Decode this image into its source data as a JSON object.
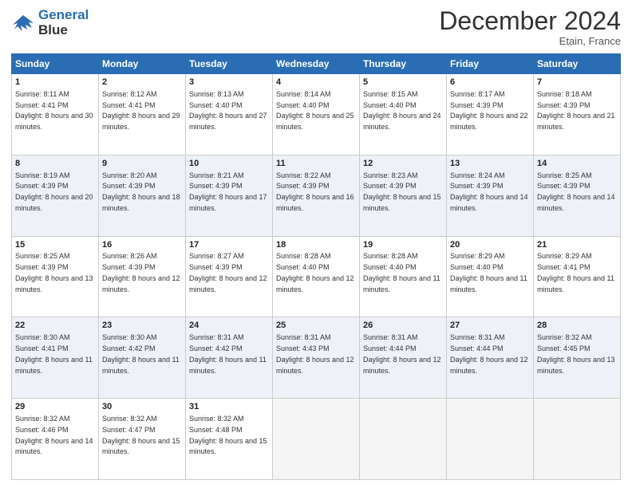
{
  "header": {
    "logo_line1": "General",
    "logo_line2": "Blue",
    "month": "December 2024",
    "location": "Etain, France"
  },
  "weekdays": [
    "Sunday",
    "Monday",
    "Tuesday",
    "Wednesday",
    "Thursday",
    "Friday",
    "Saturday"
  ],
  "weeks": [
    [
      {
        "day": "1",
        "sunrise": "8:11 AM",
        "sunset": "4:41 PM",
        "daylight": "8 hours and 30 minutes."
      },
      {
        "day": "2",
        "sunrise": "8:12 AM",
        "sunset": "4:41 PM",
        "daylight": "8 hours and 29 minutes."
      },
      {
        "day": "3",
        "sunrise": "8:13 AM",
        "sunset": "4:40 PM",
        "daylight": "8 hours and 27 minutes."
      },
      {
        "day": "4",
        "sunrise": "8:14 AM",
        "sunset": "4:40 PM",
        "daylight": "8 hours and 25 minutes."
      },
      {
        "day": "5",
        "sunrise": "8:15 AM",
        "sunset": "4:40 PM",
        "daylight": "8 hours and 24 minutes."
      },
      {
        "day": "6",
        "sunrise": "8:17 AM",
        "sunset": "4:39 PM",
        "daylight": "8 hours and 22 minutes."
      },
      {
        "day": "7",
        "sunrise": "8:18 AM",
        "sunset": "4:39 PM",
        "daylight": "8 hours and 21 minutes."
      }
    ],
    [
      {
        "day": "8",
        "sunrise": "8:19 AM",
        "sunset": "4:39 PM",
        "daylight": "8 hours and 20 minutes."
      },
      {
        "day": "9",
        "sunrise": "8:20 AM",
        "sunset": "4:39 PM",
        "daylight": "8 hours and 18 minutes."
      },
      {
        "day": "10",
        "sunrise": "8:21 AM",
        "sunset": "4:39 PM",
        "daylight": "8 hours and 17 minutes."
      },
      {
        "day": "11",
        "sunrise": "8:22 AM",
        "sunset": "4:39 PM",
        "daylight": "8 hours and 16 minutes."
      },
      {
        "day": "12",
        "sunrise": "8:23 AM",
        "sunset": "4:39 PM",
        "daylight": "8 hours and 15 minutes."
      },
      {
        "day": "13",
        "sunrise": "8:24 AM",
        "sunset": "4:39 PM",
        "daylight": "8 hours and 14 minutes."
      },
      {
        "day": "14",
        "sunrise": "8:25 AM",
        "sunset": "4:39 PM",
        "daylight": "8 hours and 14 minutes."
      }
    ],
    [
      {
        "day": "15",
        "sunrise": "8:25 AM",
        "sunset": "4:39 PM",
        "daylight": "8 hours and 13 minutes."
      },
      {
        "day": "16",
        "sunrise": "8:26 AM",
        "sunset": "4:39 PM",
        "daylight": "8 hours and 12 minutes."
      },
      {
        "day": "17",
        "sunrise": "8:27 AM",
        "sunset": "4:39 PM",
        "daylight": "8 hours and 12 minutes."
      },
      {
        "day": "18",
        "sunrise": "8:28 AM",
        "sunset": "4:40 PM",
        "daylight": "8 hours and 12 minutes."
      },
      {
        "day": "19",
        "sunrise": "8:28 AM",
        "sunset": "4:40 PM",
        "daylight": "8 hours and 11 minutes."
      },
      {
        "day": "20",
        "sunrise": "8:29 AM",
        "sunset": "4:40 PM",
        "daylight": "8 hours and 11 minutes."
      },
      {
        "day": "21",
        "sunrise": "8:29 AM",
        "sunset": "4:41 PM",
        "daylight": "8 hours and 11 minutes."
      }
    ],
    [
      {
        "day": "22",
        "sunrise": "8:30 AM",
        "sunset": "4:41 PM",
        "daylight": "8 hours and 11 minutes."
      },
      {
        "day": "23",
        "sunrise": "8:30 AM",
        "sunset": "4:42 PM",
        "daylight": "8 hours and 11 minutes."
      },
      {
        "day": "24",
        "sunrise": "8:31 AM",
        "sunset": "4:42 PM",
        "daylight": "8 hours and 11 minutes."
      },
      {
        "day": "25",
        "sunrise": "8:31 AM",
        "sunset": "4:43 PM",
        "daylight": "8 hours and 12 minutes."
      },
      {
        "day": "26",
        "sunrise": "8:31 AM",
        "sunset": "4:44 PM",
        "daylight": "8 hours and 12 minutes."
      },
      {
        "day": "27",
        "sunrise": "8:31 AM",
        "sunset": "4:44 PM",
        "daylight": "8 hours and 12 minutes."
      },
      {
        "day": "28",
        "sunrise": "8:32 AM",
        "sunset": "4:45 PM",
        "daylight": "8 hours and 13 minutes."
      }
    ],
    [
      {
        "day": "29",
        "sunrise": "8:32 AM",
        "sunset": "4:46 PM",
        "daylight": "8 hours and 14 minutes."
      },
      {
        "day": "30",
        "sunrise": "8:32 AM",
        "sunset": "4:47 PM",
        "daylight": "8 hours and 15 minutes."
      },
      {
        "day": "31",
        "sunrise": "8:32 AM",
        "sunset": "4:48 PM",
        "daylight": "8 hours and 15 minutes."
      },
      null,
      null,
      null,
      null
    ]
  ]
}
